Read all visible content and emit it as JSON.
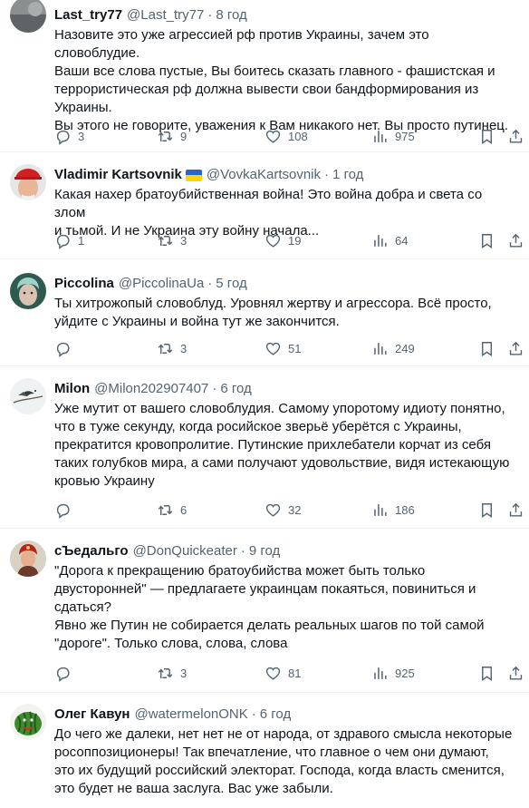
{
  "tweets": [
    {
      "name": "Last_try77",
      "handle": "@Last_try77",
      "sep": "·",
      "time": "8 год",
      "text": "Назовите это уже агрессией рф против Украины, зачем это словоблудие.\nВаши все слова пустые, Вы боитесь сказать главного - фашистская и\nтеррористическая рф должна вывести свои бандформирования из\nУкраины.\nВы этого не говорите, уважения к Вам никакого нет. Вы просто путинец.",
      "replies": "3",
      "retweets": "9",
      "likes": "108",
      "views": "975",
      "avatar": "partial"
    },
    {
      "name": "Vladimir Kartsovnik",
      "handle": "@VovkaKartsovnik",
      "sep": "·",
      "time": "1 год",
      "text": "Какая нахер братоубийственная война! Это война добра и света со злом\nи тьмой. И не Украина эту войну начала...",
      "replies": "1",
      "retweets": "3",
      "likes": "19",
      "views": "64",
      "avatar": "man-red-cap",
      "flag": "ukraine-flag"
    },
    {
      "name": "Piccolina",
      "handle": "@PiccolinaUa",
      "sep": "·",
      "time": "5 год",
      "text": "Ты хитрожопый словоблуд. Уровнял жертву и агрессора. Всё просто,\nуйдите с Украины и война тут же закончится.",
      "replies": "",
      "retweets": "3",
      "likes": "51",
      "views": "249",
      "avatar": "fantasy-portrait"
    },
    {
      "name": "Milon",
      "handle": "@Milon202907407",
      "sep": "·",
      "time": "6 год",
      "text": "Уже мутит от вашего словоблудия. Самому упоротому идиоту понятно,\nчто в туже секунду, когда росийское зверьё уберётся с Украины,\nпрекратится кровопролитие. Путинские прихлебатели корчат из себя\nтаких голубков мира, а сами получают удовольствие, видя истекающую\nкровью Украину",
      "replies": "",
      "retweets": "6",
      "likes": "32",
      "views": "186",
      "avatar": "bird-on-branch"
    },
    {
      "name": "сЪедальго",
      "handle": "@DonQuickeater",
      "sep": "·",
      "time": "9 год",
      "text": "\"Дорога к прекращению братоубийства может быть только\nдвусторонней\" — предлагаете украинцам покаяться, повиниться и\nсдаться?\nЯвно же Путин не собирается делать реальных шагов по той самой\n\"дороге\". Только слова, слова, слова",
      "replies": "",
      "retweets": "3",
      "likes": "81",
      "views": "925",
      "avatar": "knight-portrait"
    },
    {
      "name": "Олег Кавун",
      "handle": "@watermelonONK",
      "sep": "·",
      "time": "6 год",
      "text": "До чего же далеки, нет нет не от народа, от здравого смысла некоторые\nросоппозиционеры!  Так впечатление, что главное о чем они думают,\nэто их будущий российский электорат. Господа, когда власть сменится,\nэто будет не ваша заслуга. Вас уже забыли.",
      "avatar": "watermelon"
    }
  ],
  "colors": {
    "text": "#0f1419",
    "secondary": "#536471",
    "divider": "#eff3f4"
  }
}
